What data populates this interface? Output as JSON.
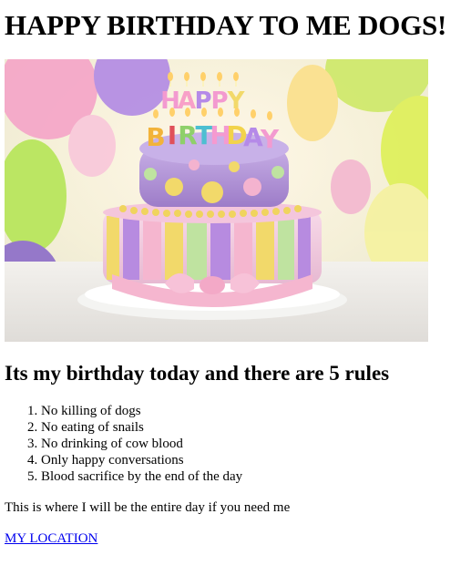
{
  "page": {
    "title": "HAPPY BIRTHDAY TO ME DOGS!",
    "subtitle": "Its my birthday today and there are 5 rules",
    "rules": [
      "No killing of dogs",
      "No eating of snails",
      "No drinking of cow blood",
      "Only happy conversations",
      "Blood sacrifice by the end of the day"
    ],
    "info_text": "This is where I will be the entire day if you need me",
    "location_link": "MY LOCATION"
  },
  "image": {
    "subject": "birthday-cake-photo",
    "candle_letters": [
      "H",
      "A",
      "P",
      "P",
      "Y",
      "B",
      "I",
      "R",
      "T",
      "H",
      "D",
      "A",
      "Y"
    ]
  },
  "colors": {
    "text": "#000000",
    "link": "#0000ee",
    "cake_top": "#b69ad8",
    "cake_bottom": "#f3cde0",
    "stripe_yellow": "#f2d96a",
    "stripe_green": "#bfe3a0",
    "stripe_purple": "#b78be0",
    "ribbon_pink": "#f5b6cf"
  }
}
